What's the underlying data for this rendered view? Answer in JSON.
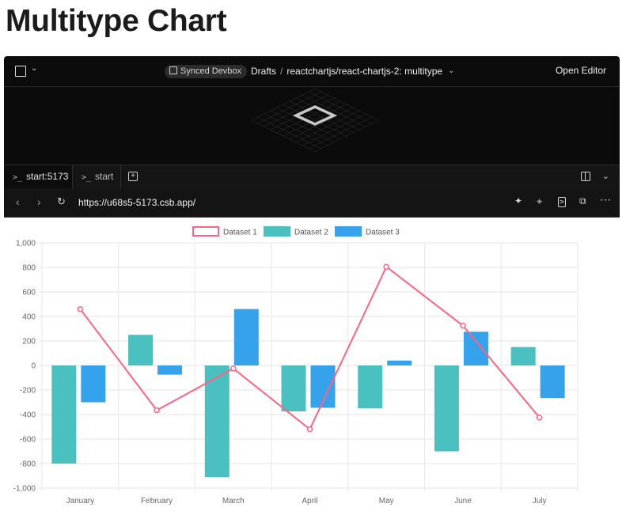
{
  "page": {
    "title": "Multitype Chart"
  },
  "header": {
    "badge": "Synced Devbox",
    "breadcrumb": [
      "Drafts",
      "reactchartjs/react-chartjs-2: multitype"
    ],
    "breadcrumb_sep": "/",
    "open_editor": "Open Editor"
  },
  "tabs": [
    {
      "label": "start:5173"
    },
    {
      "label": "start"
    }
  ],
  "browser": {
    "url": "https://u68s5-5173.csb.app/"
  },
  "icons": {
    "header": [
      "square-icon",
      "chevron-down-icon",
      "box-icon"
    ],
    "urlbar": [
      "back-icon",
      "forward-icon",
      "reload-icon",
      "sparkle-icon",
      "crosshair-icon",
      "terminal-icon",
      "popout-icon",
      "more-icon"
    ]
  },
  "colors": {
    "dataset1_line": "#ff6384",
    "dataset1_fill": "#ffffff",
    "dataset2": "#4bc0c0",
    "dataset3": "#36a2eb"
  },
  "chart_data": {
    "type": "bar",
    "categories": [
      "January",
      "February",
      "March",
      "April",
      "May",
      "June",
      "July"
    ],
    "series": [
      {
        "name": "Dataset 1",
        "type": "line",
        "values": [
          460,
          -365,
          -25,
          -520,
          805,
          325,
          -425
        ]
      },
      {
        "name": "Dataset 2",
        "type": "bar",
        "values": [
          -800,
          250,
          -910,
          -375,
          -350,
          -700,
          150
        ]
      },
      {
        "name": "Dataset 3",
        "type": "bar",
        "values": [
          -300,
          -75,
          460,
          -345,
          40,
          275,
          -265
        ]
      }
    ],
    "y_ticks": [
      "1,000",
      "800",
      "600",
      "400",
      "200",
      "0",
      "-200",
      "-400",
      "-600",
      "-800",
      "-1,000"
    ],
    "ylim": [
      -1000,
      1000
    ],
    "legend": "top-center",
    "grid": true
  }
}
